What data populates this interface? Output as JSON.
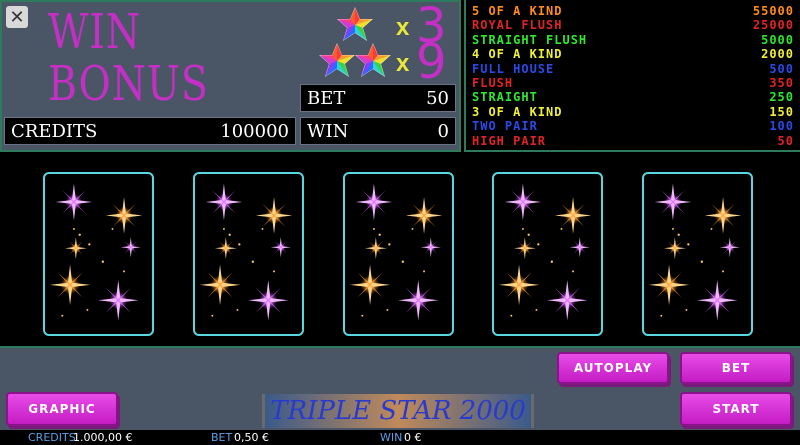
{
  "header": {
    "title_line1": "WIN",
    "title_line2": "BONUS",
    "multipliers": [
      {
        "symbol": "x",
        "value": "3",
        "stars": 1
      },
      {
        "symbol": "x",
        "value": "9",
        "stars": 2
      }
    ],
    "credits_label": "CREDITS",
    "credits_value": "100000",
    "bet_label": "BET",
    "bet_value": "50",
    "win_label": "WIN",
    "win_value": "0"
  },
  "paytable": [
    {
      "hand": "5 OF A KIND",
      "payout": "55000",
      "color": "#ff8c1a"
    },
    {
      "hand": "ROYAL FLUSH",
      "payout": "25000",
      "color": "#e02424"
    },
    {
      "hand": "STRAIGHT FLUSH",
      "payout": "5000",
      "color": "#2ee82e"
    },
    {
      "hand": "4 OF A KIND",
      "payout": "2000",
      "color": "#f0f03a"
    },
    {
      "hand": "FULL HOUSE",
      "payout": "500",
      "color": "#2a4ae8"
    },
    {
      "hand": "FLUSH",
      "payout": "350",
      "color": "#e02424"
    },
    {
      "hand": "STRAIGHT",
      "payout": "250",
      "color": "#2ee82e"
    },
    {
      "hand": "3 OF A KIND",
      "payout": "150",
      "color": "#f0f03a"
    },
    {
      "hand": "TWO PAIR",
      "payout": "100",
      "color": "#2a4ae8"
    },
    {
      "hand": "HIGH PAIR",
      "payout": "50",
      "color": "#e02424"
    }
  ],
  "controls": {
    "graphic_label": "GRAPHIC",
    "autoplay_label": "AUTOPLAY",
    "bet_label": "BET",
    "start_label": "START",
    "game_title": "TRIPLE STAR 2000"
  },
  "status": {
    "credits_label": "CREDITS",
    "credits_value": "1.000,00 €",
    "bet_label": "BET",
    "bet_value": "0,50 €",
    "win_label": "WIN",
    "win_value": "0 €"
  },
  "cards": [
    {
      "face": "card-back"
    },
    {
      "face": "card-back"
    },
    {
      "face": "card-back"
    },
    {
      "face": "card-back"
    },
    {
      "face": "card-back"
    }
  ],
  "colors": {
    "accent_magenta": "#c62fc6",
    "panel_gray": "#4a5566",
    "card_border": "#5ad6e0",
    "border_green": "#2d7a5c"
  }
}
